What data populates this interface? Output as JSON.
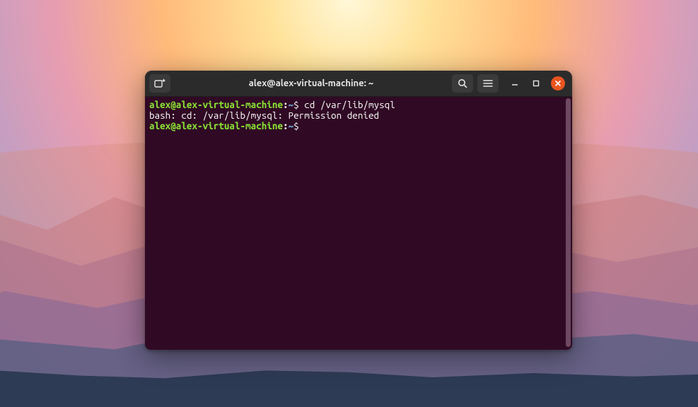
{
  "window": {
    "title": "alex@alex-virtual-machine: ~"
  },
  "icons": {
    "new_tab": "new-tab-icon",
    "search": "search-icon",
    "menu": "hamburger-icon",
    "minimize": "minimize-icon",
    "maximize": "maximize-icon",
    "close": "close-icon"
  },
  "terminal": {
    "lines": [
      {
        "prompt": {
          "user": "alex@alex-virtual-machine",
          "colon": ":",
          "cwd": "~",
          "sigil": "$"
        },
        "command": " cd /var/lib/mysql"
      },
      {
        "output": "bash: cd: /var/lib/mysql: Permission denied"
      },
      {
        "prompt": {
          "user": "alex@alex-virtual-machine",
          "colon": ":",
          "cwd": "~",
          "sigil": "$"
        },
        "command": " "
      }
    ]
  },
  "colors": {
    "terminal_bg": "#300a24",
    "titlebar_bg": "#2b2b2b",
    "close_btn": "#e95420",
    "prompt_user": "#89e234",
    "prompt_cwd": "#6d9fcf"
  }
}
